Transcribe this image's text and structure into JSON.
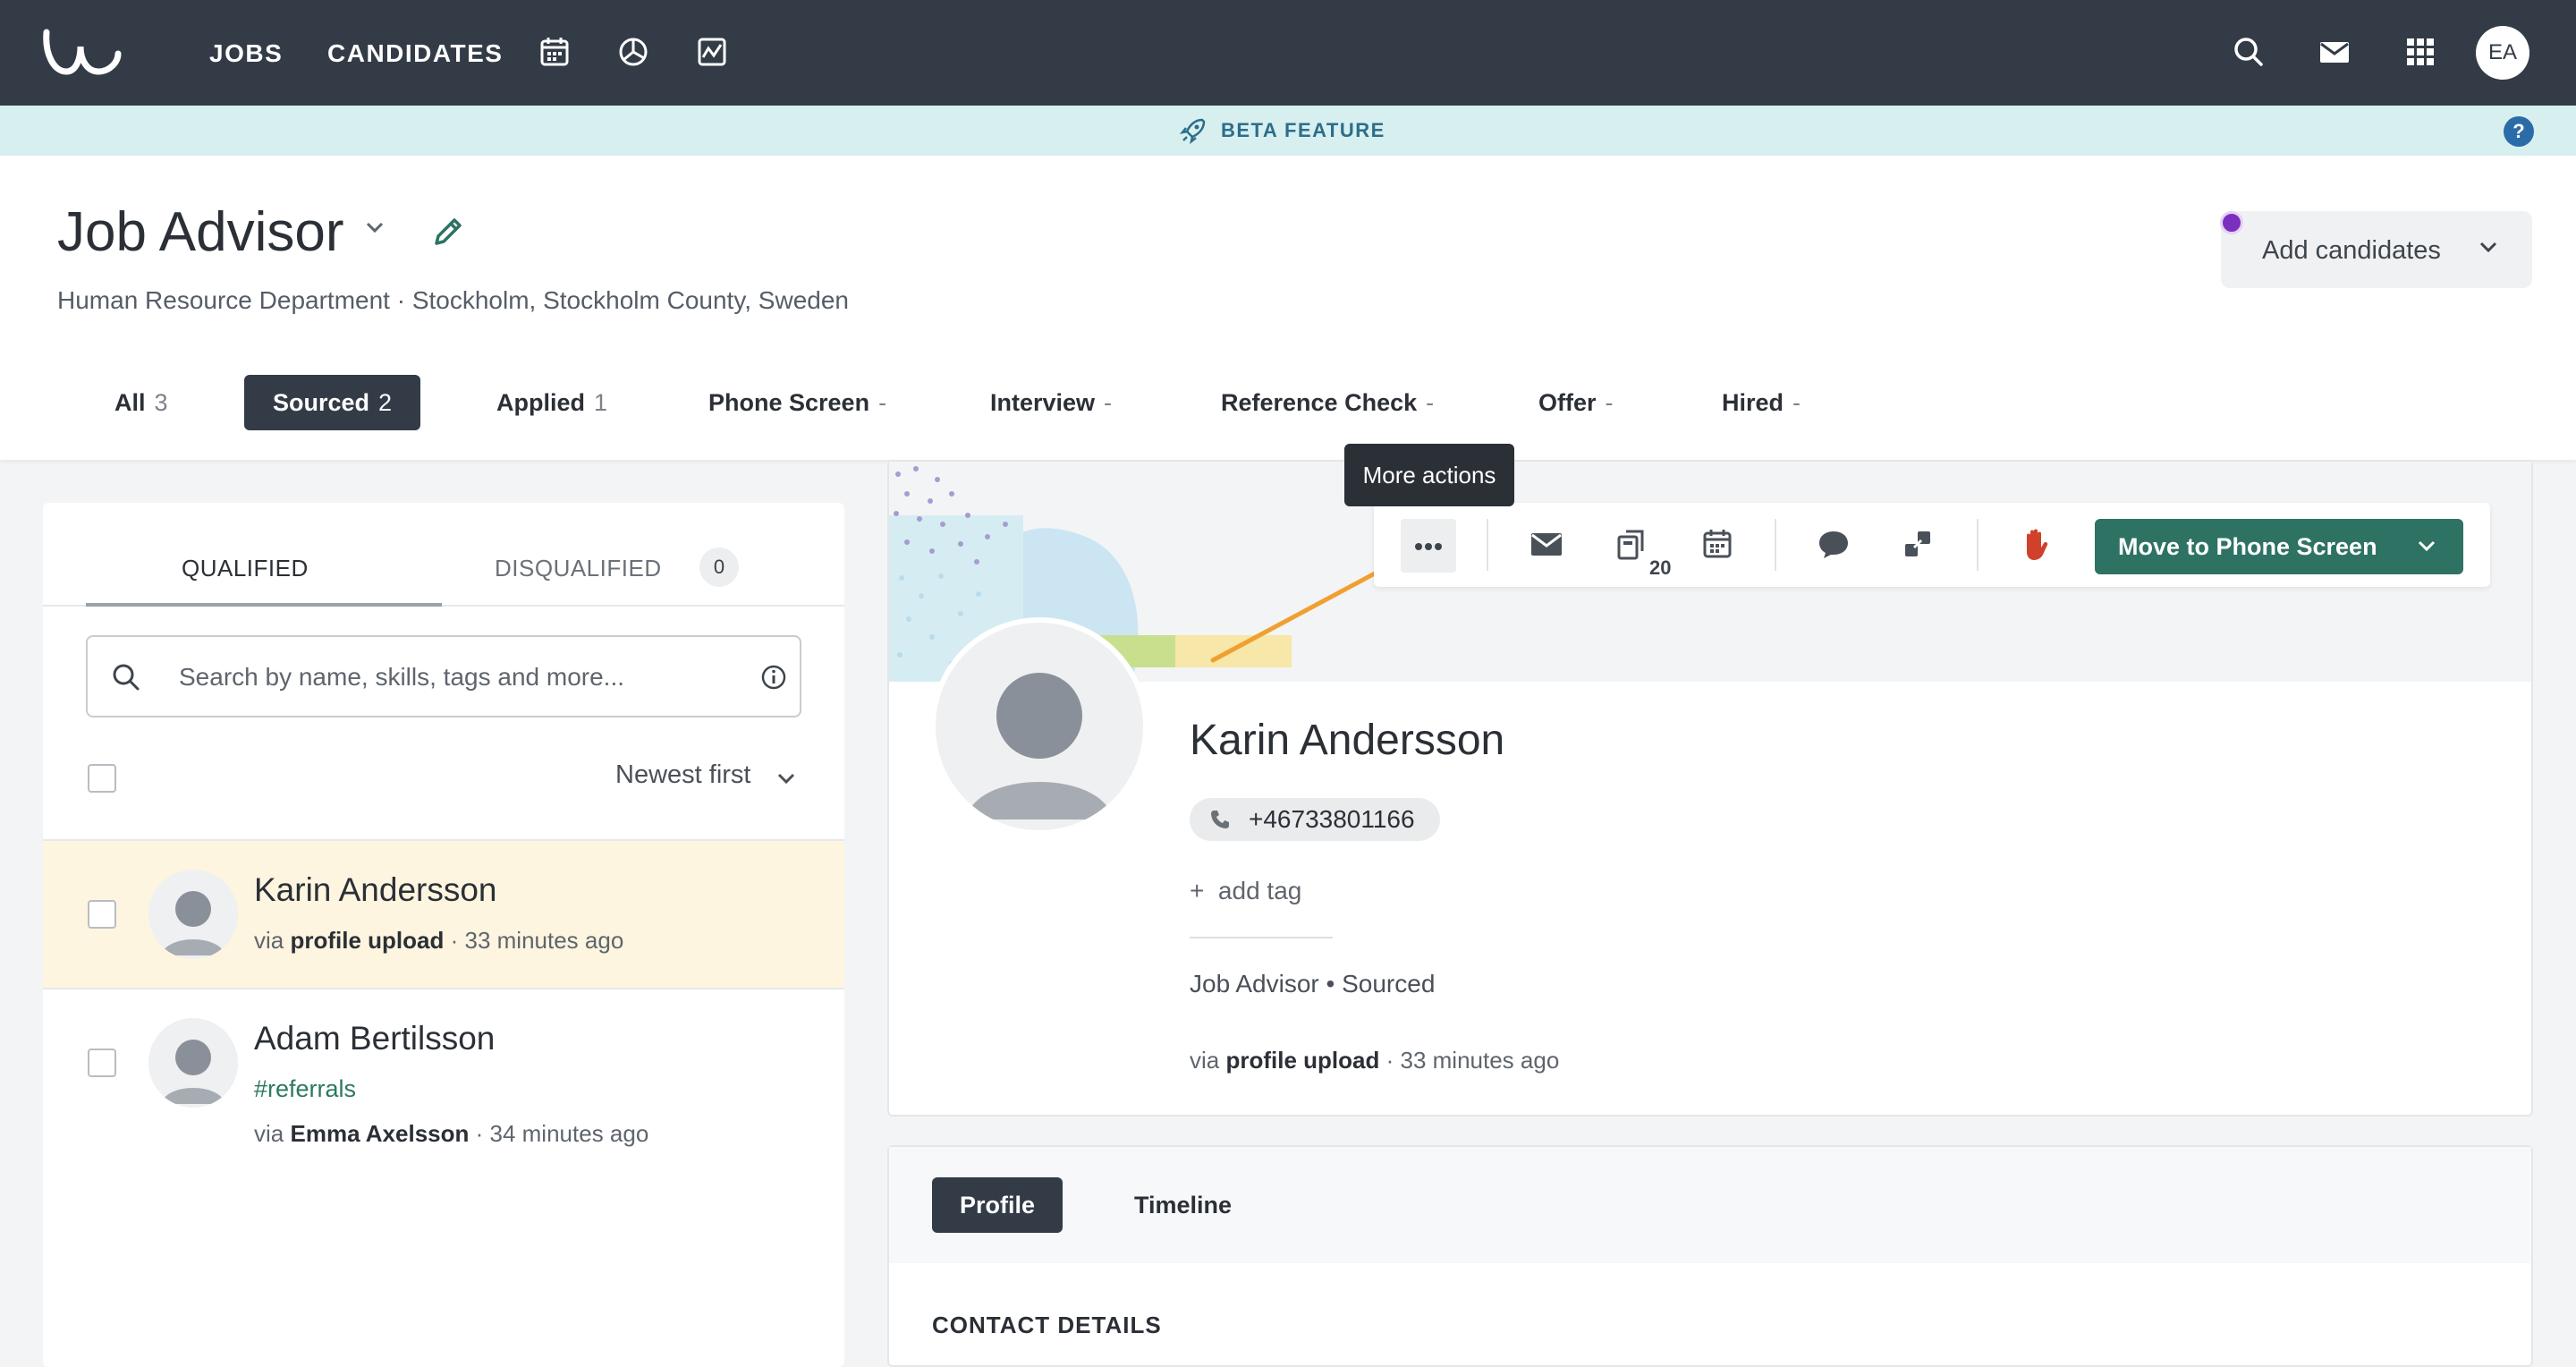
{
  "nav": {
    "jobs": "JOBS",
    "candidates": "CANDIDATES",
    "avatar_initials": "EA"
  },
  "banner": {
    "label": "BETA FEATURE",
    "help": "?"
  },
  "job": {
    "title": "Job Advisor",
    "subtitle": "Human Resource Department · Stockholm, Stockholm County, Sweden",
    "add_candidates": "Add candidates"
  },
  "stages": [
    {
      "label": "All",
      "count": "3"
    },
    {
      "label": "Sourced",
      "count": "2"
    },
    {
      "label": "Applied",
      "count": "1"
    },
    {
      "label": "Phone Screen",
      "count": "-"
    },
    {
      "label": "Interview",
      "count": "-"
    },
    {
      "label": "Reference Check",
      "count": "-"
    },
    {
      "label": "Offer",
      "count": "-"
    },
    {
      "label": "Hired",
      "count": "-"
    }
  ],
  "list": {
    "tab_qualified": "QUALIFIED",
    "tab_disqualified": "DISQUALIFIED",
    "disqualified_count": "0",
    "search_placeholder": "Search by name, skills, tags and more...",
    "sort": "Newest first",
    "candidates": [
      {
        "name": "Karin Andersson",
        "via_prefix": "via",
        "via_source": "profile upload",
        "time": "· 33 minutes ago",
        "tag": ""
      },
      {
        "name": "Adam Bertilsson",
        "via_prefix": "via",
        "via_source": "Emma Axelsson",
        "time": "· 34 minutes ago",
        "tag": "#referrals"
      }
    ]
  },
  "toolbar": {
    "tooltip": "More actions",
    "attachment_count": "20",
    "move_button": "Move to Phone Screen"
  },
  "profile": {
    "name": "Karin Andersson",
    "phone": "+46733801166",
    "add_tag": "add tag",
    "add_tag_plus": "+",
    "job_stage": "Job Advisor • Sourced",
    "via_prefix": "via",
    "via_source": "profile upload",
    "time": "· 33 minutes ago"
  },
  "detail_tabs": {
    "profile": "Profile",
    "timeline": "Timeline"
  },
  "section": {
    "contact": "CONTACT DETAILS"
  },
  "colors": {
    "nav_bg": "#333b47",
    "banner_bg": "#d8eff0",
    "accent_green": "#2e7264",
    "selected_row": "#fdf5df",
    "stop_red": "#d0412b",
    "arrow_orange": "#f0a030",
    "dot_purple": "#7b2fbe"
  },
  "icons": {
    "logo": "brand-logo-icon",
    "calendar": "calendar-icon",
    "reports": "pie-chart-icon",
    "insights": "activity-chart-icon",
    "search": "search-icon",
    "mail": "mail-icon",
    "apps": "grid-icon"
  }
}
